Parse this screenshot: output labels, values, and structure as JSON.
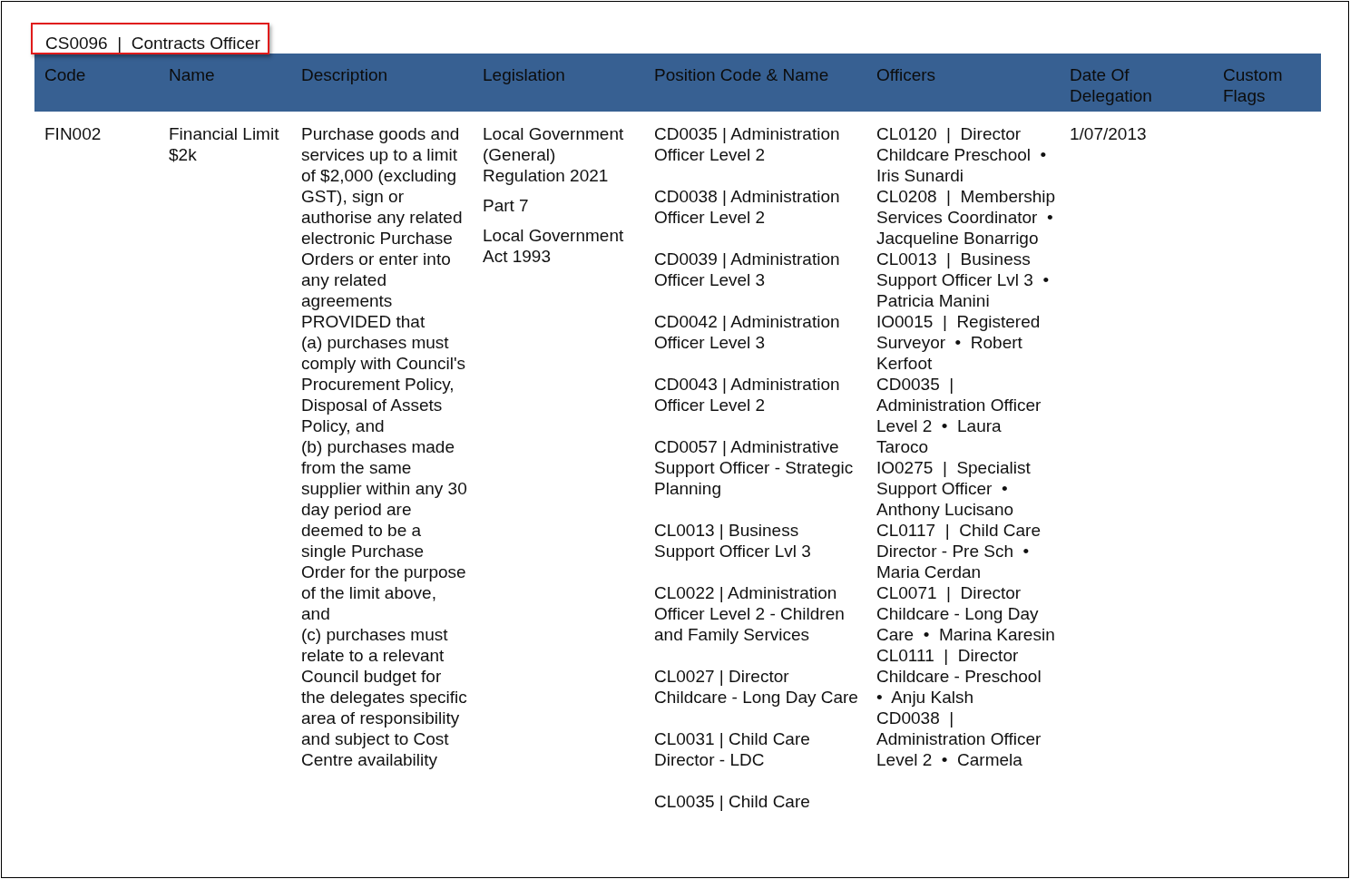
{
  "title": "CS0096  |  Contracts Officer",
  "table": {
    "columns": [
      "Code",
      "Name",
      "Description",
      "Legislation",
      "Position Code & Name",
      "Officers",
      "Date Of Delegation",
      "Custom Flags"
    ],
    "rows": [
      {
        "code": "FIN002",
        "name": "Financial Limit $2k",
        "description": [
          "Purchase goods and services up to a limit of $2,000 (excluding GST), sign or authorise any related electronic Purchase Orders or enter into any related agreements PROVIDED that",
          "(a) purchases must comply with Council's Procurement Policy, Disposal of Assets Policy, and",
          "(b) purchases made from the same supplier within any 30 day period are deemed to be a single Purchase Order for the purpose of the limit above, and",
          "(c) purchases must relate to a relevant Council budget for the delegates specific area of responsibility and subject to Cost Centre availability"
        ],
        "legislation": [
          "Local Government (General) Regulation 2021",
          "Part 7",
          "Local Government Act 1993"
        ],
        "positions": [
          "CD0035 | Administration Officer Level 2",
          "CD0038 | Administration Officer Level 2",
          "CD0039 | Administration Officer Level 3",
          "CD0042 | Administration Officer Level 3",
          "CD0043 | Administration Officer Level 2",
          "CD0057 | Administrative Support Officer - Strategic Planning",
          "CL0013 | Business Support Officer Lvl 3",
          "CL0022 | Administration Officer Level 2 - Children and Family Services",
          "CL0027 | Director Childcare - Long Day Care",
          "CL0031 | Child Care Director - LDC",
          "CL0035 | Child Care"
        ],
        "officers": [
          "CL0120  |  Director Childcare Preschool  •  Iris Sunardi",
          "CL0208  |  Membership Services Coordinator  •  Jacqueline Bonarrigo",
          "CL0013  |  Business Support Officer Lvl 3  •  Patricia Manini",
          "IO0015  |  Registered Surveyor  •  Robert Kerfoot",
          "CD0035  |  Administration Officer Level 2  •  Laura Taroco",
          "IO0275  |  Specialist Support Officer  •  Anthony Lucisano",
          "CL0117  |  Child Care Director - Pre Sch  •  Maria Cerdan",
          "CL0071  |  Director Childcare - Long Day Care  •  Marina Karesin",
          "CL0111  |  Director Childcare - Preschool  •  Anju Kalsh",
          "CD0038  |  Administration Officer Level 2  •  Carmela"
        ],
        "date": "1/07/2013"
      }
    ]
  }
}
